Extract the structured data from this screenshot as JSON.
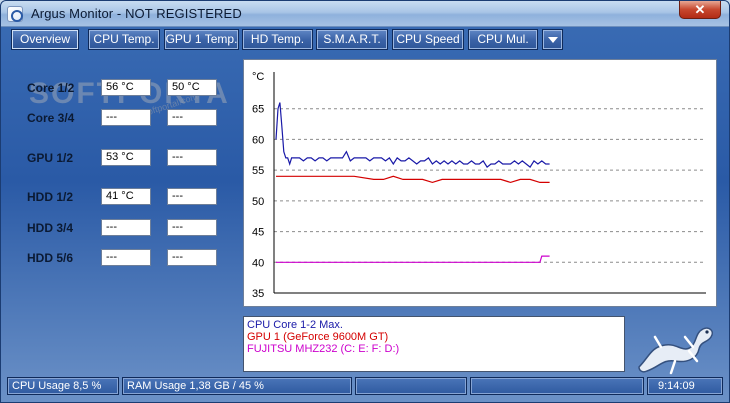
{
  "window": {
    "title": "Argus Monitor - NOT REGISTERED",
    "close_label": "✕"
  },
  "tabs": [
    {
      "label": "Overview",
      "active": true
    },
    {
      "label": "CPU Temp.",
      "active": false
    },
    {
      "label": "GPU 1 Temp.",
      "active": false
    },
    {
      "label": "HD Temp.",
      "active": false
    },
    {
      "label": "S.M.A.R.T.",
      "active": false
    },
    {
      "label": "CPU Speed",
      "active": false
    },
    {
      "label": "CPU Mul.",
      "active": false
    }
  ],
  "sensors": [
    {
      "label": "Core 1/2",
      "value1": "56 °C",
      "value2": "50 °C"
    },
    {
      "label": "Core 3/4",
      "value1": "---",
      "value2": "---"
    },
    {
      "label": "GPU 1/2",
      "value1": "53 °C",
      "value2": "---"
    },
    {
      "label": "HDD 1/2",
      "value1": "41 °C",
      "value2": "---"
    },
    {
      "label": "HDD 3/4",
      "value1": "---",
      "value2": "---"
    },
    {
      "label": "HDD 5/6",
      "value1": "---",
      "value2": "---"
    }
  ],
  "watermark": {
    "text": "SOFTPORTAL",
    "url": "www.softportal.com"
  },
  "chart_data": {
    "type": "line",
    "unit_label": "°C",
    "ylim": [
      35,
      70
    ],
    "yticks": [
      35,
      40,
      45,
      50,
      55,
      60,
      65
    ],
    "grid": true,
    "series": [
      {
        "name": "CPU Core 1-2 Max.",
        "color": "#1a1aa8",
        "x": [
          0,
          1,
          2,
          3,
          4,
          5,
          6,
          7,
          8,
          9,
          10,
          12,
          14,
          16,
          18,
          20,
          22,
          24,
          26,
          28,
          30,
          32,
          34,
          36,
          38,
          40,
          42,
          44,
          46,
          48,
          50,
          52,
          54,
          56,
          58,
          60,
          62,
          64,
          66,
          68,
          70,
          72,
          74,
          76,
          78,
          80,
          82,
          84,
          86,
          88,
          90,
          92,
          94,
          96,
          98,
          100,
          102,
          104,
          106,
          108,
          110,
          112,
          114,
          116,
          118,
          120,
          122,
          124,
          126,
          128,
          130,
          132,
          134,
          136,
          138,
          140
        ],
        "values": [
          60,
          65,
          66,
          62,
          58,
          57,
          57,
          56,
          57,
          57,
          57,
          57,
          56.5,
          57,
          57,
          56.5,
          57,
          57,
          56.5,
          57,
          57,
          57,
          57,
          58,
          56.5,
          57,
          57,
          57,
          57,
          56.5,
          57,
          57,
          57,
          56.5,
          57,
          56,
          57,
          56.5,
          56.5,
          57,
          56.5,
          56,
          56.5,
          56.5,
          57,
          56,
          56.5,
          56,
          56.5,
          56,
          56.5,
          56,
          56.5,
          56,
          56,
          56.5,
          56,
          56,
          56.5,
          55.5,
          56,
          56,
          56.5,
          56,
          56,
          56,
          56.5,
          56,
          56.5,
          56,
          55.5,
          56.5,
          56,
          56.5,
          56,
          56
        ]
      },
      {
        "name": "GPU 1 (GeForce 9600M GT)",
        "color": "#d40000",
        "x": [
          0,
          10,
          20,
          30,
          40,
          50,
          55,
          60,
          65,
          70,
          75,
          80,
          85,
          90,
          95,
          100,
          105,
          110,
          115,
          120,
          125,
          130,
          135,
          140
        ],
        "values": [
          54,
          54,
          54,
          54,
          54,
          53.5,
          53.5,
          54,
          53.5,
          53.5,
          53.5,
          53,
          53.5,
          53.5,
          53.5,
          53.5,
          53.5,
          53.5,
          53.5,
          53,
          53.5,
          53.5,
          53,
          53
        ]
      },
      {
        "name": "FUJITSU MHZ232 (C: E: F: D:)",
        "color": "#cc00cc",
        "x": [
          0,
          20,
          40,
          60,
          80,
          100,
          120,
          135,
          136,
          140
        ],
        "values": [
          40,
          40,
          40,
          40,
          40,
          40,
          40,
          40,
          41,
          41
        ]
      }
    ]
  },
  "status": {
    "cpu_usage": "CPU Usage 8,5 %",
    "ram_usage": "RAM Usage 1,38 GB / 45 %",
    "time": "9:14:09"
  }
}
